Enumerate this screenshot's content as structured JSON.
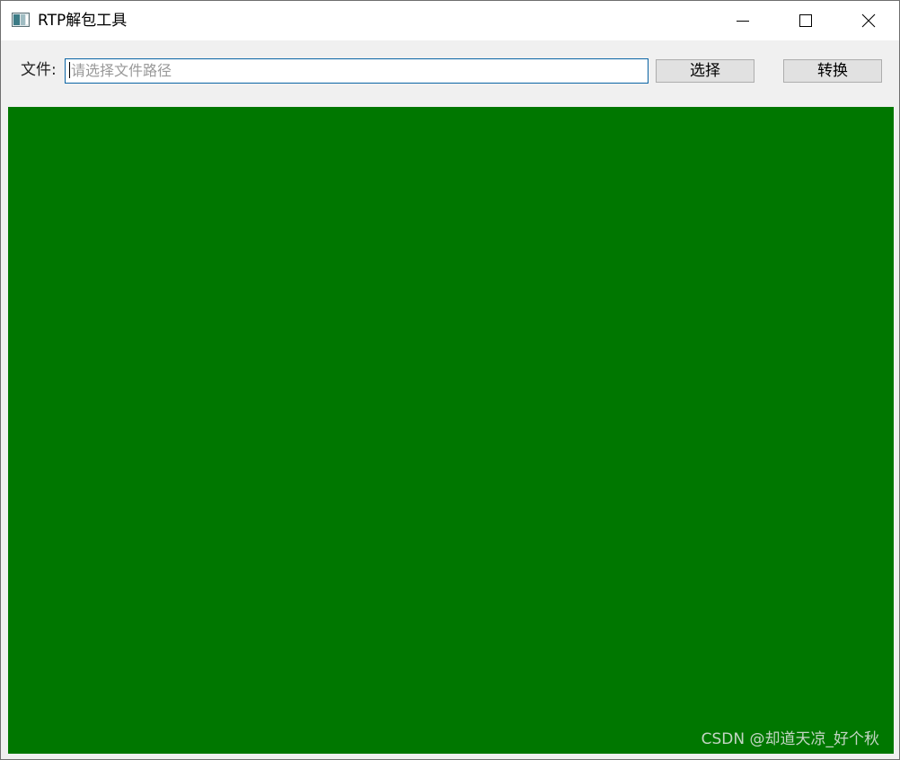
{
  "window": {
    "title": "RTP解包工具",
    "icon": "app-window-icon"
  },
  "title_controls": {
    "minimize": "minimize-icon",
    "maximize": "maximize-icon",
    "close": "close-icon"
  },
  "toolbar": {
    "file_label": "文件:",
    "path_placeholder": "请选择文件路径",
    "path_value": "",
    "select_button": "选择",
    "convert_button": "转换"
  },
  "panel": {
    "background": "#007700"
  },
  "watermark": {
    "text": "CSDN @却道天凉_好个秋"
  }
}
